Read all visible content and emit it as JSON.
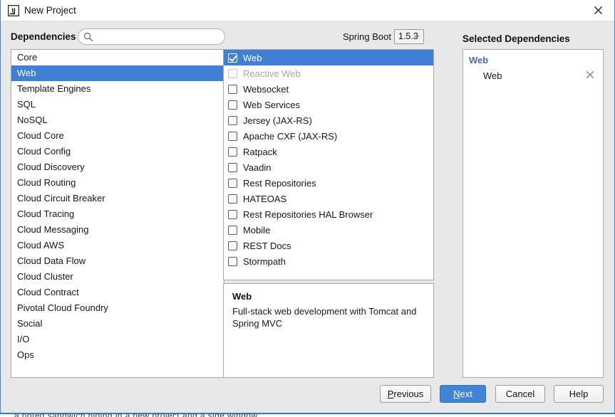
{
  "window": {
    "title": "New Project",
    "app_icon": "intellij-idea-icon",
    "close_icon": "close-icon",
    "border_color": "#3c86d8"
  },
  "header": {
    "dependencies_label": "Dependencies",
    "search": {
      "icon": "search-icon",
      "value": "",
      "placeholder": ""
    },
    "spring_boot_label": "Spring Boot",
    "spring_boot_version": "1.5.3",
    "selected_dependencies_title": "Selected Dependencies"
  },
  "categories": {
    "selected": "Web",
    "items": [
      {
        "label": "Core",
        "selected": false
      },
      {
        "label": "Web",
        "selected": true
      },
      {
        "label": "Template Engines",
        "selected": false
      },
      {
        "label": "SQL",
        "selected": false
      },
      {
        "label": "NoSQL",
        "selected": false
      },
      {
        "label": "Cloud Core",
        "selected": false
      },
      {
        "label": "Cloud Config",
        "selected": false
      },
      {
        "label": "Cloud Discovery",
        "selected": false
      },
      {
        "label": "Cloud Routing",
        "selected": false
      },
      {
        "label": "Cloud Circuit Breaker",
        "selected": false
      },
      {
        "label": "Cloud Tracing",
        "selected": false
      },
      {
        "label": "Cloud Messaging",
        "selected": false
      },
      {
        "label": "Cloud AWS",
        "selected": false
      },
      {
        "label": "Cloud Data Flow",
        "selected": false
      },
      {
        "label": "Cloud Cluster",
        "selected": false
      },
      {
        "label": "Cloud Contract",
        "selected": false
      },
      {
        "label": "Pivotal Cloud Foundry",
        "selected": false
      },
      {
        "label": "Social",
        "selected": false
      },
      {
        "label": "I/O",
        "selected": false
      },
      {
        "label": "Ops",
        "selected": false
      }
    ]
  },
  "dependencies": {
    "items": [
      {
        "label": "Web",
        "checked": true,
        "highlighted": true,
        "disabled": false
      },
      {
        "label": "Reactive Web",
        "checked": false,
        "highlighted": false,
        "disabled": true
      },
      {
        "label": "Websocket",
        "checked": false,
        "highlighted": false,
        "disabled": false
      },
      {
        "label": "Web Services",
        "checked": false,
        "highlighted": false,
        "disabled": false
      },
      {
        "label": "Jersey (JAX-RS)",
        "checked": false,
        "highlighted": false,
        "disabled": false
      },
      {
        "label": "Apache CXF (JAX-RS)",
        "checked": false,
        "highlighted": false,
        "disabled": false
      },
      {
        "label": "Ratpack",
        "checked": false,
        "highlighted": false,
        "disabled": false
      },
      {
        "label": "Vaadin",
        "checked": false,
        "highlighted": false,
        "disabled": false
      },
      {
        "label": "Rest Repositories",
        "checked": false,
        "highlighted": false,
        "disabled": false
      },
      {
        "label": "HATEOAS",
        "checked": false,
        "highlighted": false,
        "disabled": false
      },
      {
        "label": "Rest Repositories HAL Browser",
        "checked": false,
        "highlighted": false,
        "disabled": false
      },
      {
        "label": "Mobile",
        "checked": false,
        "highlighted": false,
        "disabled": false
      },
      {
        "label": "REST Docs",
        "checked": false,
        "highlighted": false,
        "disabled": false
      },
      {
        "label": "Stormpath",
        "checked": false,
        "highlighted": false,
        "disabled": false
      }
    ]
  },
  "description": {
    "title": "Web",
    "text": "Full-stack web development with Tomcat and Spring MVC"
  },
  "selected_dependencies": {
    "groups": [
      {
        "title": "Web",
        "items": [
          {
            "label": "Web",
            "remove_icon": "close-icon"
          }
        ]
      }
    ]
  },
  "footer": {
    "previous": {
      "pre": "",
      "mnemonic": "P",
      "post": "revious"
    },
    "next": {
      "pre": "",
      "mnemonic": "N",
      "post": "ext"
    },
    "cancel": {
      "pre": "Cancel",
      "mnemonic": "",
      "post": ""
    },
    "help": {
      "pre": "Help",
      "mnemonic": "",
      "post": ""
    }
  },
  "colors": {
    "selection_blue": "#3f7fd4",
    "primary_button": "#4183d7",
    "group_title": "#4a67a8",
    "disabled_text": "#a6a6a6"
  },
  "backdrop": {
    "sliver_text": "a noted sandwich hiding in a new project and a side window"
  }
}
